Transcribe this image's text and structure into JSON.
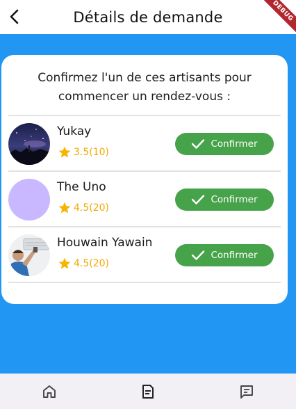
{
  "appbar": {
    "title": "Détails de demande",
    "debug_label": "DEBUG"
  },
  "card": {
    "instruction": "Confirmez l'un de ces artisants pour commencer un rendez-vous :",
    "artisans": [
      {
        "name": "Yukay",
        "rating": "3.5(10)",
        "confirm_label": "Confirmer",
        "avatar": "photo-night-sky"
      },
      {
        "name": "The Uno",
        "rating": "4.5(20)",
        "confirm_label": "Confirmer",
        "avatar": "placeholder-lavender"
      },
      {
        "name": "Houwain Yawain",
        "rating": "4.5(20)",
        "confirm_label": "Confirmer",
        "avatar": "photo-technician"
      }
    ]
  },
  "bottom_nav": [
    {
      "icon": "home-icon"
    },
    {
      "icon": "document-icon",
      "active": true
    },
    {
      "icon": "chat-icon"
    }
  ],
  "colors": {
    "background": "#2196F3",
    "confirm_button": "#46a34a",
    "rating": "#f0a800",
    "avatar_placeholder": "#c9b8ff",
    "nav_background": "#f2eff5"
  }
}
